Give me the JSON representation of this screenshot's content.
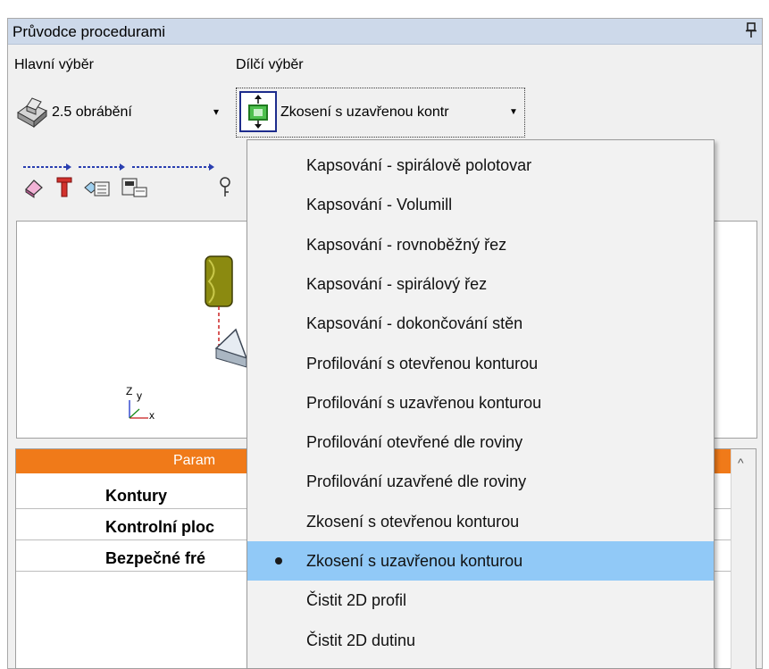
{
  "panel": {
    "title": "Průvodce procedurami"
  },
  "main_selection": {
    "label": "Hlavní výběr",
    "value": "2.5 obrábění",
    "arrow": "▾"
  },
  "sub_selection": {
    "label": "Dílčí výběr",
    "value": "Zkosení s uzavřenou kontr",
    "arrow": "▼"
  },
  "params": {
    "header": "Param",
    "rows": [
      "Kontury",
      "Kontrolní ploc",
      "Bezpečné fré"
    ],
    "scroll_up": "^"
  },
  "dropdown": {
    "items": [
      "Kapsování - spirálově polotovar",
      "Kapsování - Volumill",
      "Kapsování - rovnoběžný řez",
      "Kapsování - spirálový řez",
      "Kapsování - dokončování stěn",
      "Profilování s otevřenou konturou",
      "Profilování s uzavřenou konturou",
      "Profilování otevřené dle roviny",
      "Profilování uzavřené dle roviny",
      "Zkosení s otevřenou konturou",
      "Zkosení s uzavřenou konturou",
      "Čistit 2D profil",
      "Čistit 2D dutinu"
    ],
    "selected_index": 10
  },
  "preview": {
    "axis_z": "Z",
    "axis_y": "y",
    "axis_x": "x"
  },
  "colors": {
    "titlebar": "#cdd9ea",
    "params_header": "#f07a19",
    "selection": "#91c9f7",
    "sub_icon_border": "#1d2c8c",
    "tool_olive": "#8b8a10"
  }
}
